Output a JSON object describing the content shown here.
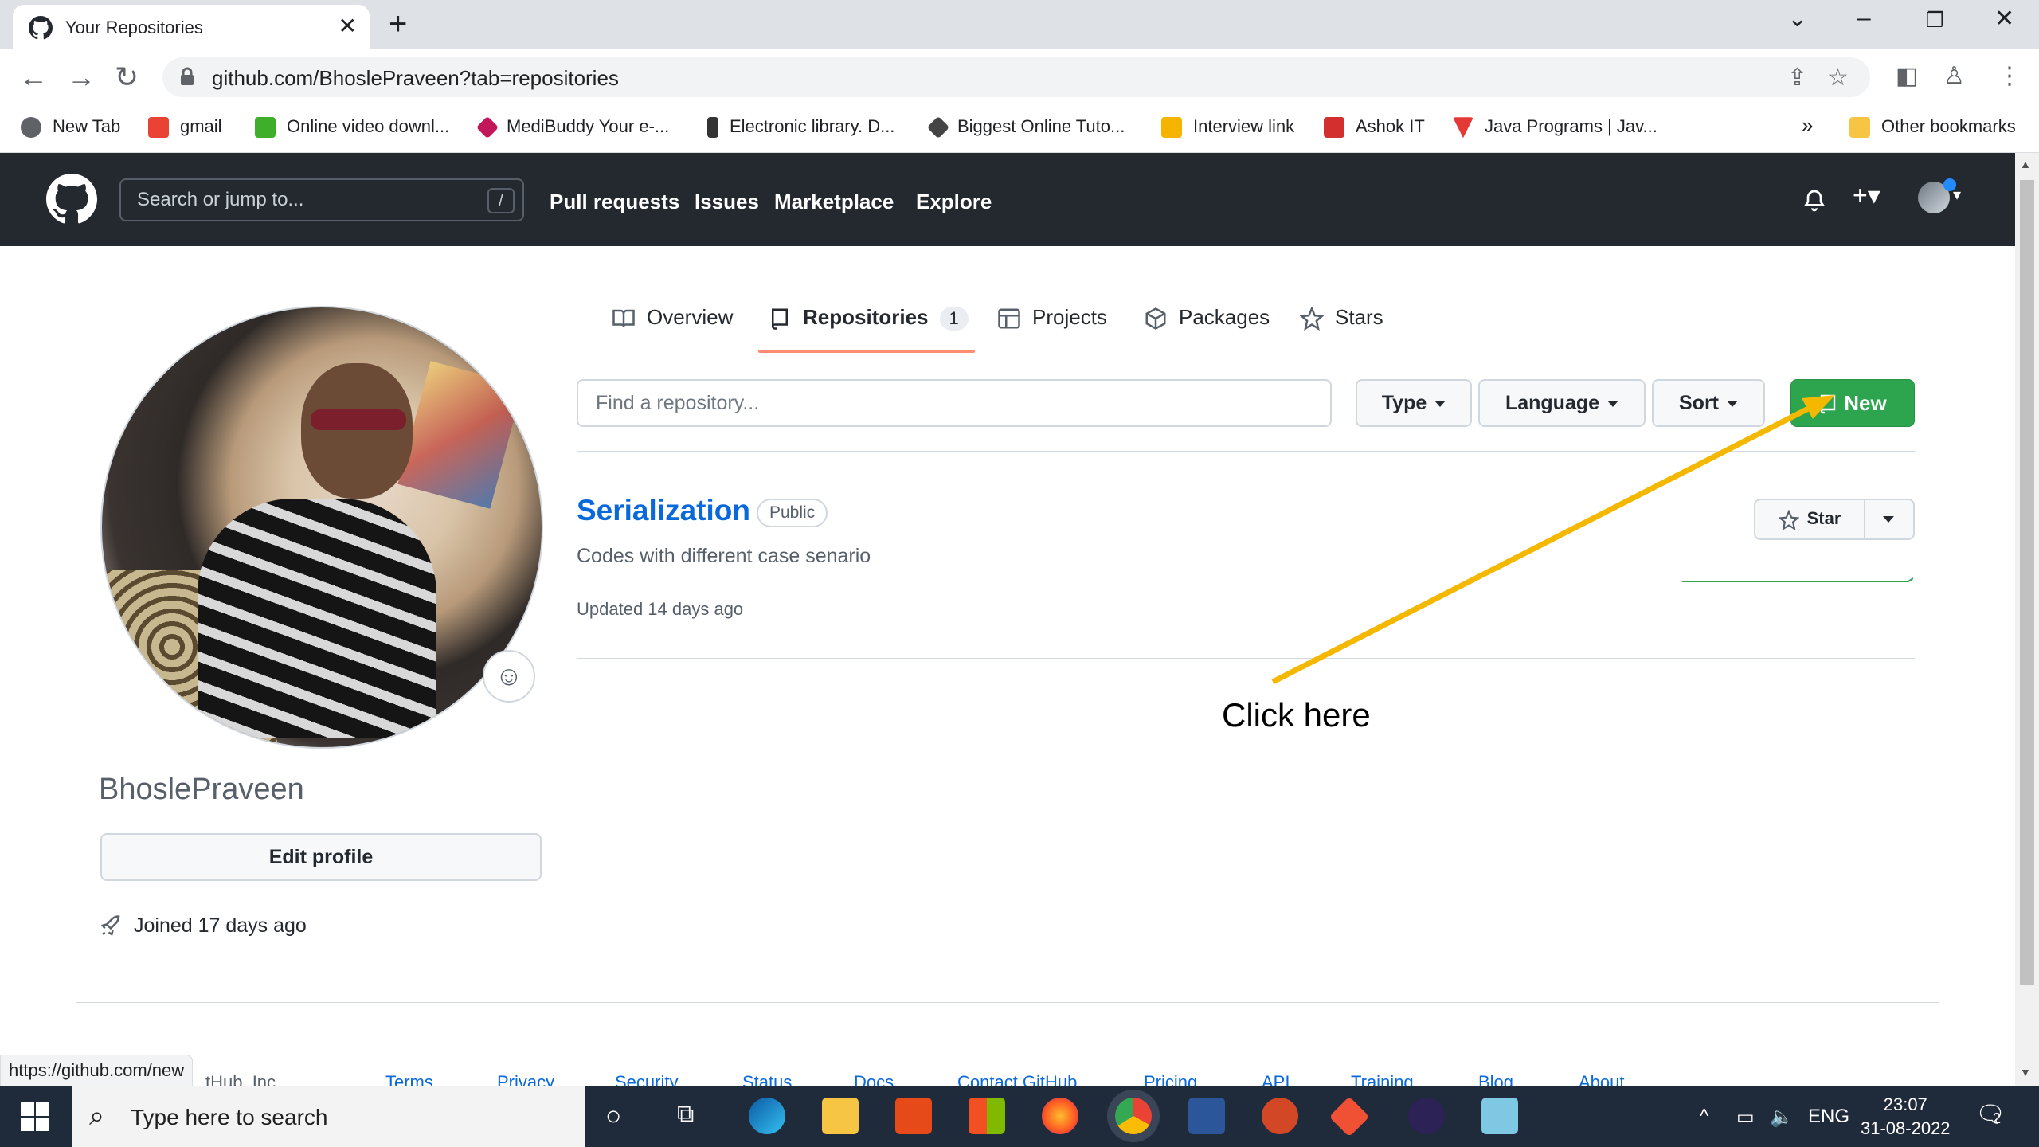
{
  "browser": {
    "tab_title": "Your Repositories",
    "new_tab_symbol": "+",
    "close_symbol": "✕",
    "url": "github.com/BhoslePraveen?tab=repositories",
    "bookmarks": [
      {
        "label": "New Tab",
        "color": "#5f6368"
      },
      {
        "label": "gmail",
        "color": "#ea4335"
      },
      {
        "label": "Online video downl...",
        "color": "#3fae2a"
      },
      {
        "label": "MediBuddy Your e-...",
        "color": "#c2185b"
      },
      {
        "label": "Electronic library. D...",
        "color": "#333333"
      },
      {
        "label": "Biggest Online Tuto...",
        "color": "#444444"
      },
      {
        "label": "Interview link",
        "color": "#f4b400"
      },
      {
        "label": "Ashok IT",
        "color": "#d32f2f"
      },
      {
        "label": "Java Programs | Jav...",
        "color": "#e53935"
      }
    ],
    "bookmarks_overflow": "»",
    "other_bookmarks": "Other bookmarks"
  },
  "github": {
    "search_placeholder": "Search or jump to...",
    "search_key": "/",
    "nav": [
      "Pull requests",
      "Issues",
      "Marketplace",
      "Explore"
    ]
  },
  "profile_tabs": [
    {
      "label": "Overview",
      "icon": "book-icon"
    },
    {
      "label": "Repositories",
      "icon": "repo-icon",
      "count": "1",
      "active": true
    },
    {
      "label": "Projects",
      "icon": "table-icon"
    },
    {
      "label": "Packages",
      "icon": "package-icon"
    },
    {
      "label": "Stars",
      "icon": "star-icon"
    }
  ],
  "profile": {
    "username": "BhoslePraveen",
    "edit_label": "Edit profile",
    "joined": "Joined 17 days ago"
  },
  "repo_filters": {
    "find_placeholder": "Find a repository...",
    "type_label": "Type",
    "language_label": "Language",
    "sort_label": "Sort",
    "new_label": "New",
    "new_color": "#2da44e"
  },
  "repositories": [
    {
      "name": "Serialization",
      "visibility": "Public",
      "description": "Codes with different case senario",
      "updated": "Updated 14 days ago",
      "star_label": "Star"
    }
  ],
  "annotation": {
    "text": "Click here",
    "arrow_color": "#f5b800"
  },
  "footer": {
    "copyright": "tHub, Inc.",
    "links": [
      "Terms",
      "Privacy",
      "Security",
      "Status",
      "Docs",
      "Contact GitHub",
      "Pricing",
      "API",
      "Training",
      "Blog",
      "About"
    ]
  },
  "status_url": "https://github.com/new",
  "taskbar": {
    "search_placeholder": "Type here to search",
    "lang": "ENG",
    "time": "23:07",
    "date": "31-08-2022",
    "notifications": "2"
  }
}
